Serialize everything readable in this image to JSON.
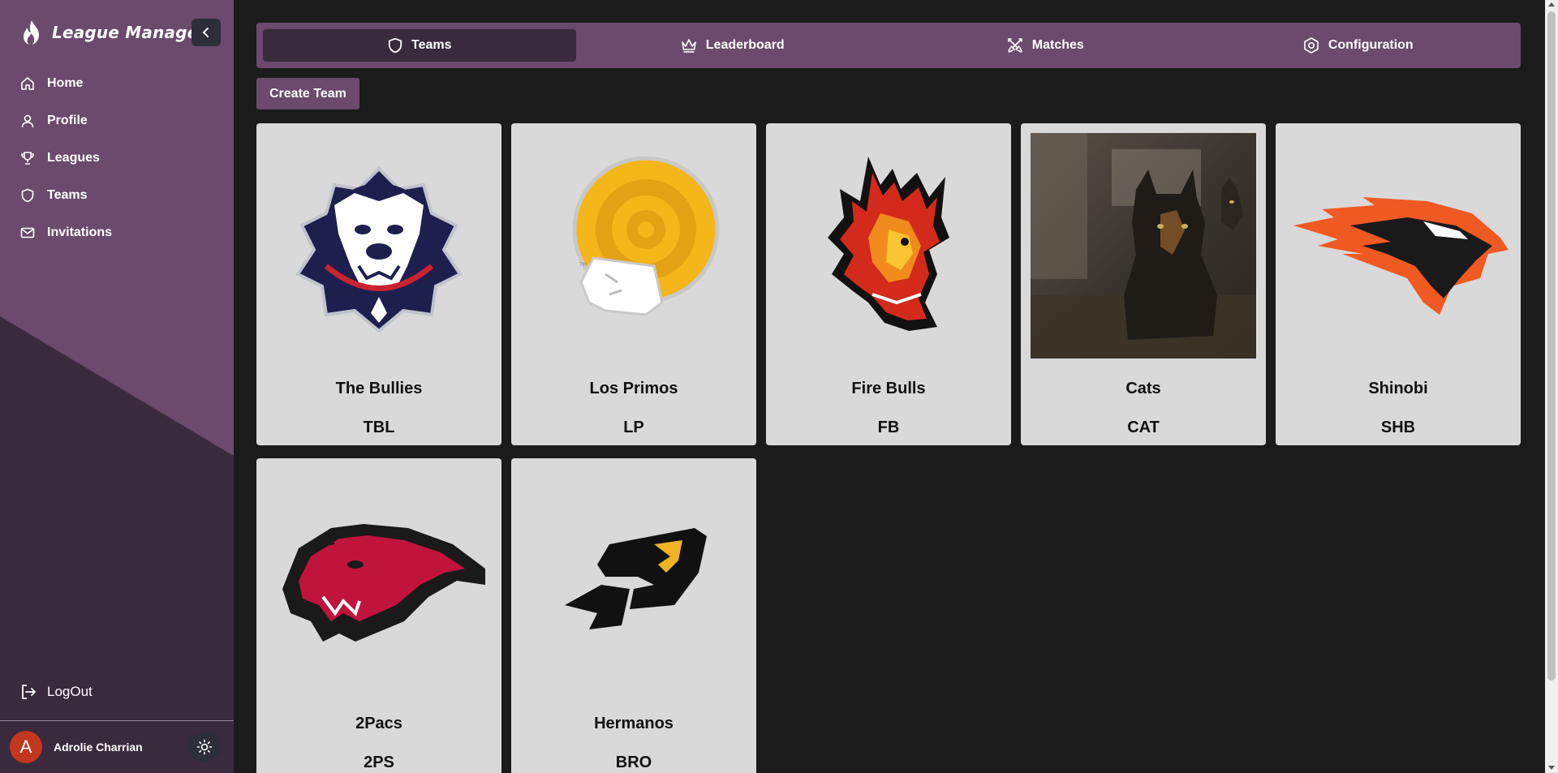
{
  "app": {
    "name": "League Manager"
  },
  "sidebar": {
    "items": [
      {
        "label": "Home",
        "icon": "home-icon"
      },
      {
        "label": "Profile",
        "icon": "user-icon"
      },
      {
        "label": "Leagues",
        "icon": "trophy-icon"
      },
      {
        "label": "Teams",
        "icon": "shield-icon"
      },
      {
        "label": "Invitations",
        "icon": "mail-icon"
      }
    ],
    "logout_label": "LogOut",
    "user": {
      "name": "Adrolie Charrian",
      "initial": "A"
    }
  },
  "tabs": [
    {
      "label": "Teams",
      "icon": "shield-icon",
      "active": true
    },
    {
      "label": "Leaderboard",
      "icon": "crown-icon",
      "active": false
    },
    {
      "label": "Matches",
      "icon": "crossed-swords-icon",
      "active": false
    },
    {
      "label": "Configuration",
      "icon": "hexagon-gear-icon",
      "active": false
    }
  ],
  "actions": {
    "create_team": "Create Team"
  },
  "teams": [
    {
      "name": "The Bullies",
      "abbr": "TBL",
      "logo": "bulldog-logo"
    },
    {
      "name": "Los Primos",
      "abbr": "LP",
      "logo": "ram-logo"
    },
    {
      "name": "Fire Bulls",
      "abbr": "FB",
      "logo": "fire-bull-logo"
    },
    {
      "name": "Cats",
      "abbr": "CAT",
      "logo": "cat-photo"
    },
    {
      "name": "Shinobi",
      "abbr": "SHB",
      "logo": "shinobi-logo"
    },
    {
      "name": "2Pacs",
      "abbr": "2PS",
      "logo": "panther-logo"
    },
    {
      "name": "Hermanos",
      "abbr": "BRO",
      "logo": "hermanos-logo"
    }
  ],
  "colors": {
    "accent": "#6b4a6d",
    "accent_dark": "#3a2a3e",
    "background": "#1b1b1b",
    "card": "#d9d9d9"
  }
}
